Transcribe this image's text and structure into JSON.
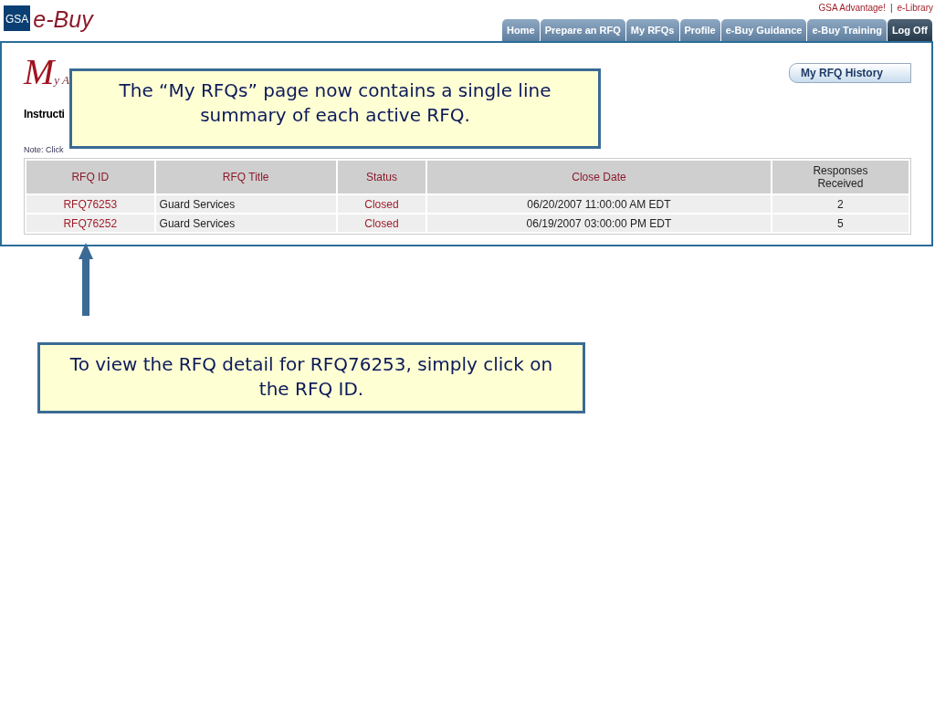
{
  "header": {
    "logo_badge": "GSA",
    "logo_text": "e-Buy",
    "links": [
      "GSA Advantage!",
      "e-Library"
    ],
    "link_separator": "|",
    "tabs": [
      {
        "label": "Home",
        "kind": "tab"
      },
      {
        "label": "Prepare an RFQ",
        "kind": "tab"
      },
      {
        "label": "My RFQs",
        "kind": "tab"
      },
      {
        "label": "Profile",
        "kind": "tab"
      },
      {
        "label": "e-Buy Guidance",
        "kind": "tab"
      },
      {
        "label": "e-Buy Training",
        "kind": "tab"
      },
      {
        "label": "Log Off",
        "kind": "logoff"
      }
    ]
  },
  "page": {
    "title": "My A",
    "instructions": "Instructi",
    "history_button": "My RFQ History",
    "note": "Note: Click",
    "table": {
      "columns": [
        {
          "label": "RFQ ID",
          "sortable": true
        },
        {
          "label": "RFQ Title",
          "sortable": true
        },
        {
          "label": "Status",
          "sortable": true
        },
        {
          "label": "Close Date",
          "sortable": true
        },
        {
          "label": "Responses Received",
          "sortable": false
        }
      ],
      "rows": [
        {
          "rfq_id": "RFQ76253",
          "title": "Guard Services",
          "status": "Closed",
          "close_date": "06/20/2007 11:00:00 AM EDT",
          "responses": "2"
        },
        {
          "rfq_id": "RFQ76252",
          "title": "Guard Services",
          "status": "Closed",
          "close_date": "06/19/2007 03:00:00 PM EDT",
          "responses": "5"
        }
      ]
    }
  },
  "callouts": [
    {
      "text": "The “My RFQs” page now contains a single line summary of each active RFQ."
    },
    {
      "text": "To view the RFQ detail for RFQ76253, simply click on the RFQ ID."
    }
  ]
}
